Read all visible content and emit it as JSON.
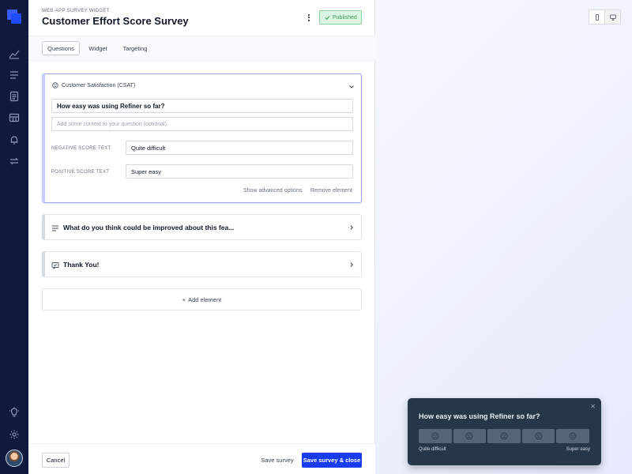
{
  "header": {
    "kicker": "WEB-APP SURVEY WIDGET",
    "title": "Customer Effort Score Survey",
    "status": "Published"
  },
  "tabs": [
    {
      "label": "Questions",
      "active": true
    },
    {
      "label": "Widget",
      "active": false
    },
    {
      "label": "Targeting",
      "active": false
    }
  ],
  "csat": {
    "type_label": "Customer Satisfaction (CSAT)",
    "question": "How easy was using Refiner so far?",
    "context_placeholder": "Add some context to your question (optional).",
    "negative_label": "NEGATIVE SCORE TEXT",
    "negative_value": "Quite difficult",
    "positive_label": "POSITIVE SCORE TEXT",
    "positive_value": "Super easy",
    "show_advanced": "Show advanced options",
    "remove": "Remove element"
  },
  "elements": [
    {
      "title": "What do you think could be improved about this fea...",
      "icon": "text-lines-icon"
    },
    {
      "title": "Thank You!",
      "icon": "message-icon"
    }
  ],
  "add_element": "Add element",
  "footer": {
    "cancel": "Cancel",
    "save": "Save survey",
    "save_close": "Save survey & close"
  },
  "widget": {
    "question": "How easy was using Refiner so far?",
    "low_label": "Quite difficult",
    "high_label": "Super easy",
    "scale_count": 5
  },
  "colors": {
    "sidebar": "#0f1a3c",
    "accent": "#1a3cf0",
    "success": "#3f9b57",
    "widget_bg": "#263749"
  }
}
